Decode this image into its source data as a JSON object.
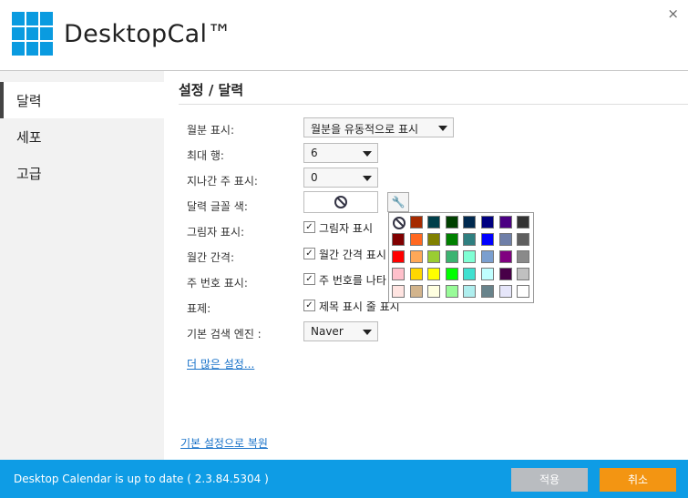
{
  "app": {
    "title": "DesktopCal™",
    "close_glyph": "×"
  },
  "sidebar": {
    "items": [
      {
        "label": "달력",
        "active": true
      },
      {
        "label": "세포",
        "active": false
      },
      {
        "label": "고급",
        "active": false
      }
    ]
  },
  "section": {
    "title": "설정 / 달력"
  },
  "settings": {
    "month_display": {
      "label": "월분 표시:",
      "value": "월분을 유동적으로 표시"
    },
    "max_rows": {
      "label": "최대 행:",
      "value": "6"
    },
    "past_weeks": {
      "label": "지나간 주 표시:",
      "value": "0"
    },
    "font_color": {
      "label": "달력 글꼴 색:",
      "icon": "no-color-icon",
      "tool_icon": "wrench-icon",
      "tool_glyph": "🔧"
    },
    "shadow": {
      "label": "그림자 표시:",
      "checkbox_label": "그림자 표시",
      "checked": true
    },
    "month_gap": {
      "label": "월간 간격:",
      "checkbox_label": "월간 간격 표시",
      "checked": true
    },
    "week_number": {
      "label": "주 번호 표시:",
      "checkbox_label": "주 번호를 나타",
      "checked": true
    },
    "title": {
      "label": "표제:",
      "checkbox_label": "제목 표시 줄 표시",
      "checked": true
    },
    "search_engine": {
      "label": "기본 검색 엔진 :",
      "value": "Naver"
    },
    "check_glyph": "✓"
  },
  "palette": {
    "rows": [
      [
        "none",
        "#a52a00",
        "#003f4a",
        "#004000",
        "#00294f",
        "#000080",
        "#4b0082",
        "#333333"
      ],
      [
        "#800000",
        "#ff6820",
        "#808000",
        "#008000",
        "#2f7f80",
        "#0000ff",
        "#6f7fa8",
        "#5f5f5f"
      ],
      [
        "#ff0000",
        "#ffa858",
        "#9acd32",
        "#3cb371",
        "#7fffd4",
        "#7b9fcf",
        "#800080",
        "#8a8a8a"
      ],
      [
        "#ffc0cb",
        "#ffd700",
        "#ffff00",
        "#00ff00",
        "#40e0d0",
        "#c0ffff",
        "#480048",
        "#c0c0c0"
      ],
      [
        "#ffe4e1",
        "#d2b48c",
        "#ffffe0",
        "#98fb98",
        "#afeeee",
        "#68838b",
        "#e6e6fa",
        "#ffffff"
      ]
    ]
  },
  "links": {
    "more_settings": "더 많은 설정...",
    "restore_default": "기본 설정으로 복원"
  },
  "footer": {
    "status": "Desktop Calendar is up to date ( 2.3.84.5304 )",
    "apply": "적용",
    "cancel": "취소"
  },
  "colors": {
    "accent_blue": "#0e9ce5",
    "cancel_orange": "#f39512",
    "apply_gray": "#b9bcc0",
    "logo_blue": "#0a9be0"
  }
}
